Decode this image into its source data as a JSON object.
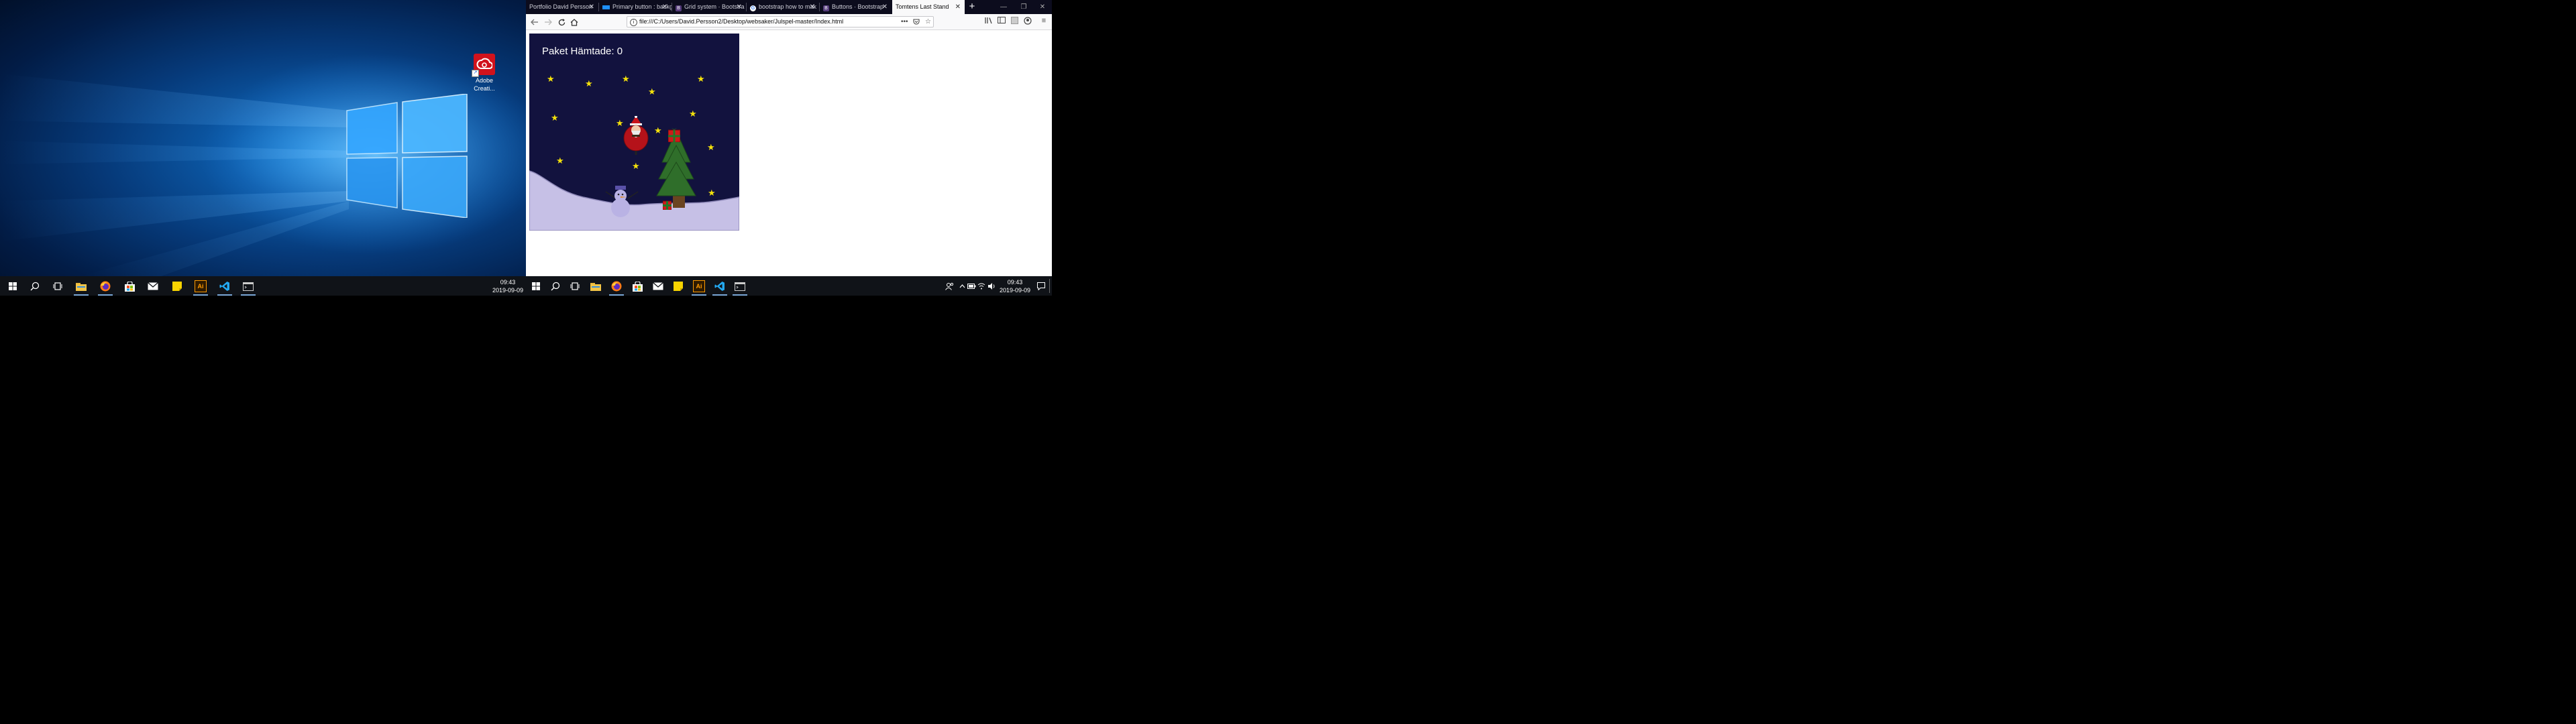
{
  "desktop": {
    "icons": [
      {
        "label": "Adobe Creati...",
        "icon": "adobe-creative-cloud-icon"
      }
    ]
  },
  "taskbar_left": {
    "apps": [
      "start-icon",
      "search-icon",
      "task-view-icon",
      "file-explorer-icon",
      "firefox-icon",
      "store-icon",
      "mail-icon",
      "sticky-notes-icon",
      "illustrator-icon",
      "vscode-icon",
      "terminal-icon"
    ],
    "illustrator_label": "Ai",
    "clock_time": "09:43",
    "clock_date": "2019-09-09"
  },
  "taskbar_right": {
    "illustrator_label": "Ai",
    "clock_time": "09:43",
    "clock_date": "2019-09-09"
  },
  "browser": {
    "tabs": [
      {
        "label": "Portfolio David Persson",
        "active": false
      },
      {
        "label": "Primary button : backg",
        "active": false
      },
      {
        "label": "Grid system · Bootstra",
        "active": false
      },
      {
        "label": "bootstrap how to mak",
        "active": false
      },
      {
        "label": "Buttons · Bootstrap",
        "active": false
      },
      {
        "label": "Tomtens Last Stand",
        "active": true
      }
    ],
    "url": "file:///C:/Users/David.Persson2/Desktop/websaker/Julspel-master/Index.html",
    "colors": {
      "tabbar": "#0c0c1d",
      "active_tab": "#f9f9fa"
    }
  },
  "game": {
    "score_text": "Paket Hämtade: 0",
    "colors": {
      "sky": "#12123e",
      "snow": "#c6c0e6",
      "star": "#f4e10b"
    }
  }
}
